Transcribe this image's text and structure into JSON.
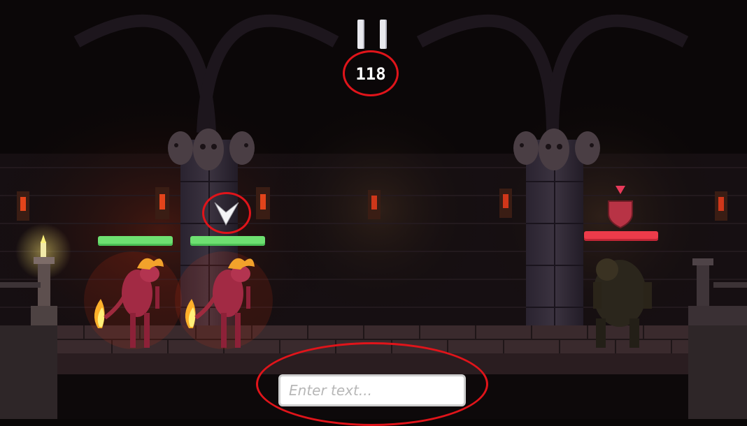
{
  "hud": {
    "pause_icon": "pause-icon",
    "counter": "118"
  },
  "party": [
    {
      "name": "fire-demon",
      "health": 1.0,
      "health_color": "#6ee071"
    },
    {
      "name": "fire-demon",
      "health": 1.0,
      "health_color": "#6ee071",
      "selected": true
    }
  ],
  "enemy": {
    "name": "ogre",
    "health": 1.0,
    "health_color": "#ec3b4a",
    "status_icon": "shield-icon",
    "target_marker": "down-arrow-icon"
  },
  "selector_icon": "chevron-down-icon",
  "input": {
    "placeholder": "Enter text..."
  },
  "colors": {
    "highlight": "#e0141a",
    "ally_health": "#6ee071",
    "enemy_health": "#ec3b4a"
  }
}
